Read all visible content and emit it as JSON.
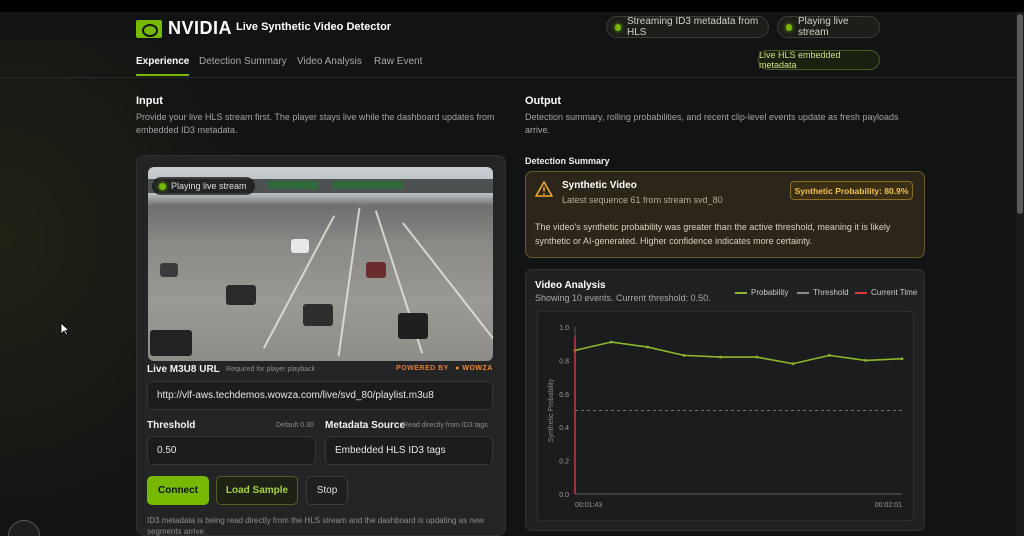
{
  "brand": {
    "logo_text": "NVIDIA",
    "app_title": "Live Synthetic Video Detector",
    "accent": "#76b900"
  },
  "header_pills": {
    "hls": "Streaming ID3 metadata from HLS",
    "live": "Playing live stream"
  },
  "nav": {
    "tabs": [
      "Experience",
      "Detection Summary",
      "Video Analysis",
      "Raw Event"
    ],
    "badge": "Live HLS embedded metadata"
  },
  "input": {
    "heading": "Input",
    "description": "Provide your live HLS stream first. The player stays live while the dashboard updates from embedded ID3 metadata.",
    "video_badge": "Playing live stream",
    "url_label": "Live M3U8 URL",
    "url_hint": "Required for player playback",
    "powered_by": "POWERED BY",
    "powered_brand": "WOWZA",
    "url_value": "http://vlf-aws.techdemos.wowza.com/live/svd_80/playlist.m3u8",
    "threshold_label": "Threshold",
    "threshold_hint": "Default 0.30",
    "threshold_value": "0.50",
    "source_label": "Metadata Source",
    "source_hint": "Read directly from ID3 tags",
    "source_value": "Embedded HLS ID3 tags",
    "connect": "Connect",
    "load_sample": "Load Sample",
    "stop": "Stop",
    "note": "ID3 metadata is being read directly from the HLS stream and the dashboard is updating as new segments arrive."
  },
  "output": {
    "heading": "Output",
    "description": "Detection summary, rolling probabilities, and recent clip-level events update as fresh payloads arrive.",
    "summary_title": "Detection Summary",
    "alert_title": "Synthetic Video",
    "alert_sub": "Latest sequence 61 from stream svd_80",
    "prob_badge": "Synthetic Probability: 80.9%",
    "alert_text": "The video's synthetic probability was greater than the active threshold, meaning it is likely synthetic or AI-generated. Higher confidence indicates more certainty.",
    "warning_color": "#f2a72b"
  },
  "analysis": {
    "title": "Video Analysis",
    "subtitle": "Showing 10 events. Current threshold: 0.50."
  },
  "chart_data": {
    "type": "line",
    "xlabel": "",
    "ylabel": "Synthetic Probability",
    "ylim": [
      0,
      1
    ],
    "yticks": [
      "0.0",
      "0.2",
      "0.4",
      "0.6",
      "0.8",
      "1.0"
    ],
    "x_start_label": "00:01:43",
    "x_end_label": "00:02:01",
    "series": [
      {
        "name": "Probability",
        "color": "#8db82b",
        "values": [
          0.86,
          0.91,
          0.88,
          0.83,
          0.82,
          0.82,
          0.78,
          0.83,
          0.8,
          0.81
        ]
      },
      {
        "name": "Threshold",
        "color": "#8a8a8a",
        "values": [
          0.5,
          0.5,
          0.5,
          0.5,
          0.5,
          0.5,
          0.5,
          0.5,
          0.5,
          0.5
        ]
      }
    ],
    "markers": [
      {
        "name": "Current Time",
        "color": "#e03a3a",
        "at_index": 0
      }
    ],
    "grid": true,
    "legend": "top-right"
  }
}
